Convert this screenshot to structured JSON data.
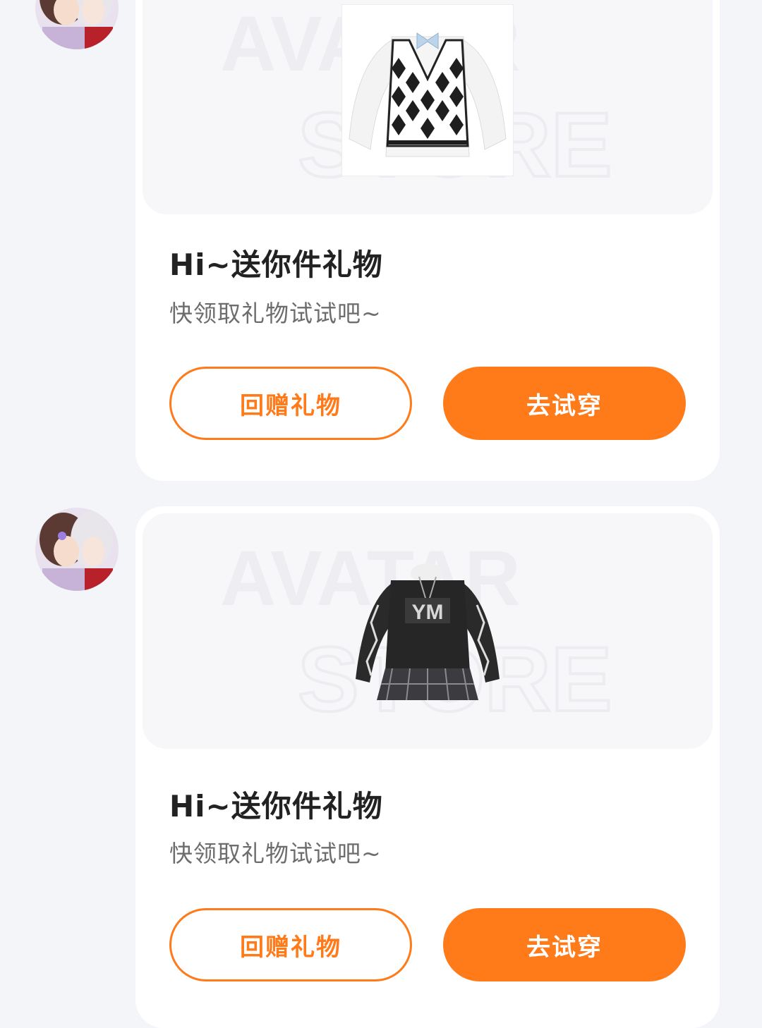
{
  "messages": [
    {
      "sender_avatar": "anime-couple-avatar",
      "gift_item": "argyle-sweater-vest-outfit",
      "watermark": [
        "AVATAR",
        "STORE"
      ],
      "title": "Hi~送你件礼物",
      "subtitle": "快领取礼物试试吧~",
      "return_gift_label": "回赠礼物",
      "try_on_label": "去试穿"
    },
    {
      "sender_avatar": "anime-couple-avatar",
      "gift_item": "black-sweatshirt-plaid-skirt-outfit",
      "watermark": [
        "AVATAR",
        "STORE"
      ],
      "title": "Hi~送你件礼物",
      "subtitle": "快领取礼物试试吧~",
      "return_gift_label": "回赠礼物",
      "try_on_label": "去试穿"
    }
  ],
  "colors": {
    "accent": "#ff7a18",
    "background": "#f4f5f9",
    "card": "#ffffff"
  }
}
